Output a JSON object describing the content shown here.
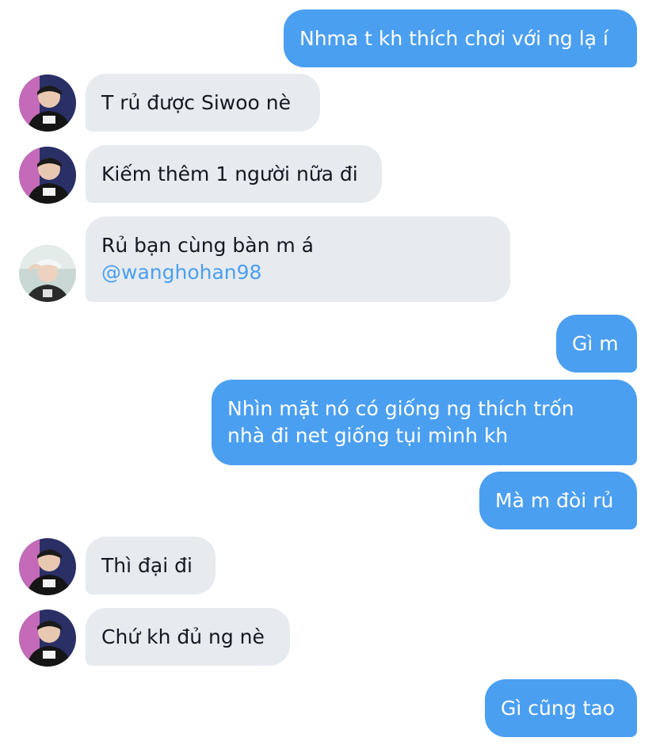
{
  "messages": [
    {
      "text": "Nhma t kh thích chơi với ng lạ í"
    },
    {
      "text": "T rủ được Siwoo nè"
    },
    {
      "text": "Kiếm thêm 1 người nữa đi"
    },
    {
      "line1": "Rủ bạn cùng bàn m á",
      "mention": "@wanghohan98"
    },
    {
      "text": "Gì m"
    },
    {
      "line1": "Nhìn mặt nó có giống ng thích trốn",
      "line2": "nhà đi net giống tụi mình kh"
    },
    {
      "text": "Mà m đòi rủ"
    },
    {
      "text": "Thì đại đi"
    },
    {
      "text": "Chứ kh đủ ng nè"
    },
    {
      "text": "Gì cũng tao"
    }
  ],
  "colors": {
    "sent_bubble": "#4b9ff0",
    "received_bubble": "#e7ebef",
    "mention": "#4b9ff0"
  }
}
